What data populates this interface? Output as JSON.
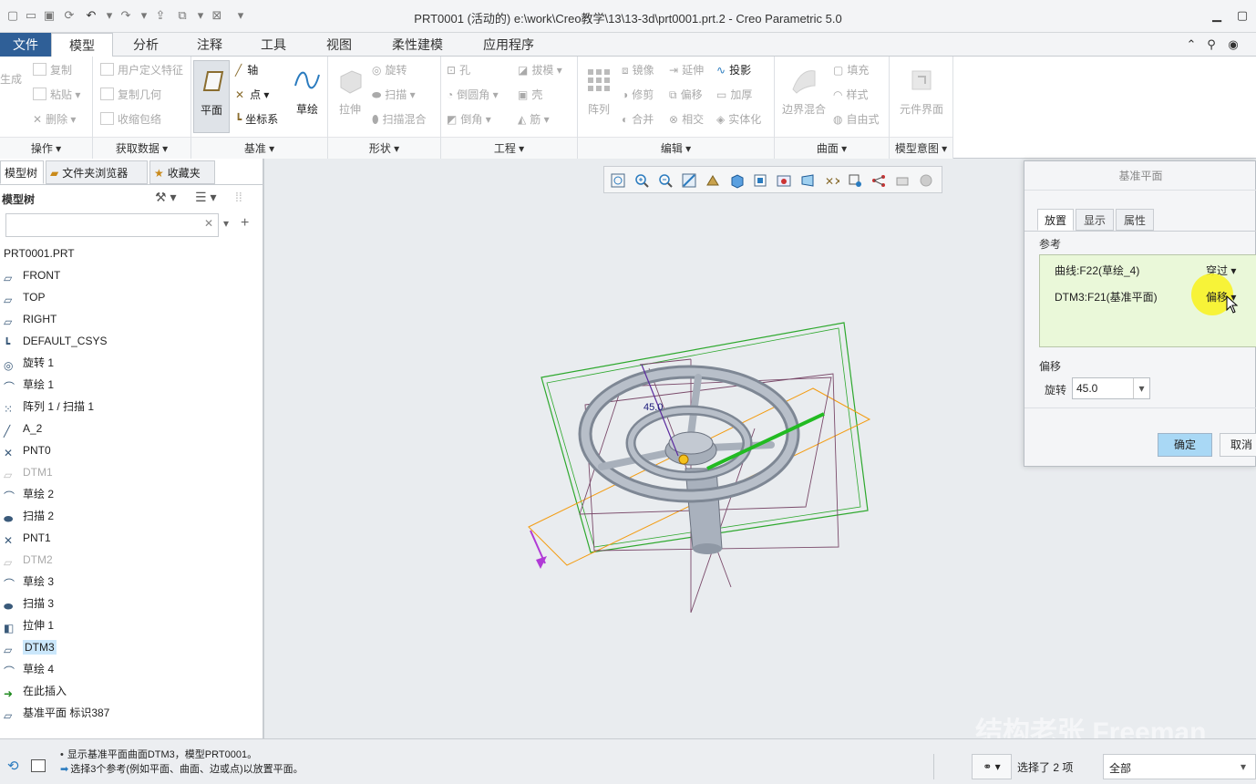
{
  "titlebar": {
    "title": "PRT0001 (活动的) e:\\work\\Creo教学\\13\\13-3d\\prt0001.prt.2 - Creo Parametric 5.0"
  },
  "tabs": [
    {
      "label": "文件"
    },
    {
      "label": "模型"
    },
    {
      "label": "分析"
    },
    {
      "label": "注释"
    },
    {
      "label": "工具"
    },
    {
      "label": "视图"
    },
    {
      "label": "柔性建模"
    },
    {
      "label": "应用程序"
    }
  ],
  "ribbon": {
    "ops": {
      "regen": "生成",
      "copy": "复制",
      "paste": "粘贴",
      "delete": "删除",
      "footer": "操作"
    },
    "getdata": {
      "udf": "用户定义特征",
      "copygeom": "复制几何",
      "shrinkwrap": "收缩包络",
      "footer": "获取数据"
    },
    "datum": {
      "plane": "平面",
      "axis": "轴",
      "point": "点",
      "csys": "坐标系",
      "sketch": "草绘",
      "footer": "基准"
    },
    "shapes": {
      "extrude": "拉伸",
      "revolve": "旋转",
      "sweep": "扫描",
      "sweptblend": "扫描混合",
      "footer": "形状"
    },
    "engineering": {
      "hole": "孔",
      "round": "倒圆角",
      "chamfer": "倒角",
      "draft": "拔模",
      "shell": "壳",
      "rib": "筋",
      "footer": "工程"
    },
    "editing": {
      "pattern": "阵列",
      "mirror": "镜像",
      "trim": "修剪",
      "merge": "合并",
      "extend": "延伸",
      "offset": "偏移",
      "intersect": "相交",
      "project": "投影",
      "thicken": "加厚",
      "solidify": "实体化",
      "footer": "编辑"
    },
    "surfaces": {
      "boundary": "边界混合",
      "fill": "填充",
      "style": "样式",
      "freestyle": "自由式",
      "footer": "曲面"
    },
    "intent": {
      "component": "元件界面",
      "footer": "模型意图"
    }
  },
  "panel": {
    "tabs": [
      {
        "label": "模型树"
      },
      {
        "label": "文件夹浏览器"
      },
      {
        "label": "收藏夹"
      }
    ],
    "header": "模型树",
    "search_placeholder": "",
    "items": [
      {
        "label": "PRT0001.PRT",
        "icon": "part-icon"
      },
      {
        "label": "FRONT",
        "icon": "datum-plane-icon"
      },
      {
        "label": "TOP",
        "icon": "datum-plane-icon"
      },
      {
        "label": "RIGHT",
        "icon": "datum-plane-icon"
      },
      {
        "label": "DEFAULT_CSYS",
        "icon": "csys-icon"
      },
      {
        "label": "旋转 1",
        "icon": "revolve-icon"
      },
      {
        "label": "草绘 1",
        "icon": "sketch-icon"
      },
      {
        "label": "阵列 1 / 扫描 1",
        "icon": "pattern-icon"
      },
      {
        "label": "A_2",
        "icon": "axis-icon"
      },
      {
        "label": "PNT0",
        "icon": "point-icon"
      },
      {
        "label": "DTM1",
        "icon": "datum-plane-icon",
        "dim": true
      },
      {
        "label": "草绘 2",
        "icon": "sketch-icon"
      },
      {
        "label": "扫描 2",
        "icon": "sweep-icon"
      },
      {
        "label": "PNT1",
        "icon": "point-icon"
      },
      {
        "label": "DTM2",
        "icon": "datum-plane-icon",
        "dim": true
      },
      {
        "label": "草绘 3",
        "icon": "sketch-icon"
      },
      {
        "label": "扫描 3",
        "icon": "sweep-icon"
      },
      {
        "label": "拉伸 1",
        "icon": "extrude-icon"
      },
      {
        "label": "DTM3",
        "icon": "datum-plane-icon",
        "selected": true
      },
      {
        "label": "草绘 4",
        "icon": "sketch-icon"
      },
      {
        "label": "在此插入",
        "icon": "insert-arrow-icon"
      },
      {
        "label": "基准平面 标识387",
        "icon": "datum-plane-icon"
      }
    ]
  },
  "viewport": {
    "angle_label": "45.0"
  },
  "dialog": {
    "title": "基准平面",
    "tabs": [
      {
        "label": "放置"
      },
      {
        "label": "显示"
      },
      {
        "label": "属性"
      }
    ],
    "refs_label": "参考",
    "refs": [
      {
        "name": "曲线:F22(草绘_4)",
        "mode": "穿过"
      },
      {
        "name": "DTM3:F21(基准平面)",
        "mode": "偏移"
      }
    ],
    "offset_label": "偏移",
    "rotate_label": "旋转",
    "rotate_value": "45.0",
    "ok": "确定",
    "cancel": "取消"
  },
  "status": {
    "line1": "显示基准平面曲面DTM3，模型PRT0001。",
    "line2": "选择3个参考(例如平面、曲面、边或点)以放置平面。",
    "selected": "选择了 2 项",
    "filter": "全部"
  },
  "watermark": "结构老张 Freeman",
  "colors": {
    "accent": "#2f5f97",
    "selection": "#cbe7fb",
    "refbox": "#eaf8d9",
    "ok_button": "#a9d8f5"
  }
}
